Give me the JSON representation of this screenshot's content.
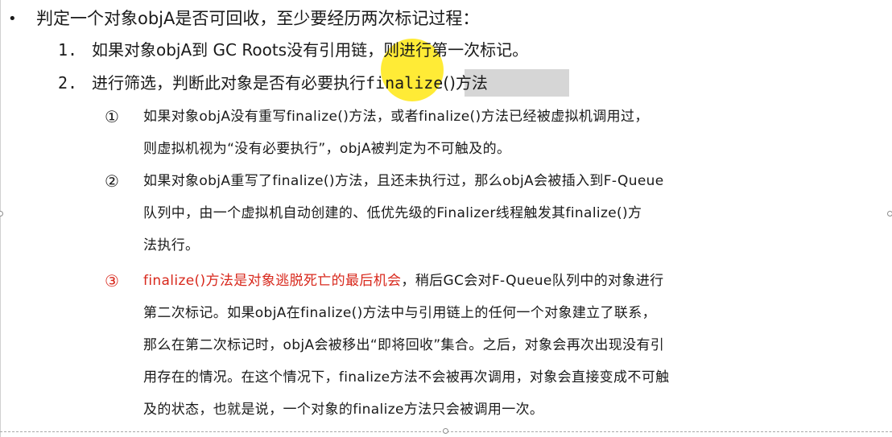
{
  "headline": {
    "bullet": "•",
    "text": "判定一个对象objA是否可回收，至少要经历两次标记过程："
  },
  "steps": [
    {
      "number": "1.",
      "text": "如果对象objA到 GC Roots没有引用链，则进行第一次标记。"
    },
    {
      "number": "2.",
      "text_before": "进行筛选，判断此对象是否有必要执行",
      "highlighted": "finalize",
      "text_after": "()方法"
    }
  ],
  "items": [
    {
      "marker": "①",
      "lines": [
        "如果对象objA没有重写finalize()方法，或者finalize()方法已经被虚拟机调用过，",
        "则虚拟机视为“没有必要执行”，objA被判定为不可触及的。"
      ]
    },
    {
      "marker": "②",
      "lines": [
        "如果对象objA重写了finalize()方法，且还未执行过，那么objA会被插入到F-Queue",
        "队列中，由一个虚拟机自动创建的、低优先级的Finalizer线程触发其finalize()方",
        "法执行。"
      ]
    },
    {
      "marker": "③",
      "first_line_red": "finalize()方法是对象逃脱死亡的最后机会",
      "first_line_rest": "，稍后GC会对F-Queue队列中的对象进行",
      "lines": [
        "第二次标记。如果objA在finalize()方法中与引用链上的任何一个对象建立了联系，",
        "那么在第二次标记时，objA会被移出“即将回收”集合。之后，对象会再次出现没有引",
        "用存在的情况。在这个情况下，finalize方法不会被再次调用，对象会直接变成不可触",
        "及的状态，也就是说，一个对象的finalize方法只会被调用一次。"
      ]
    }
  ],
  "colors": {
    "text": "#1a1a1a",
    "emphasis_red": "#d8281c",
    "cursor_highlight": "#ffe81a",
    "selection_gray": "#d6d6d6"
  }
}
